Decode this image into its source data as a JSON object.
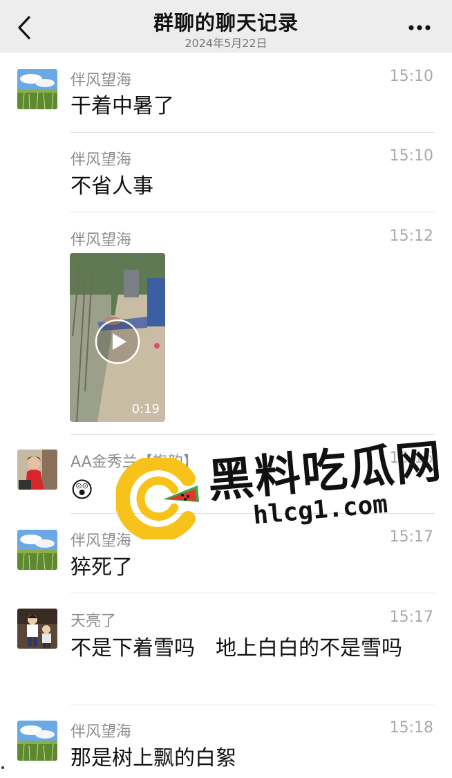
{
  "header": {
    "title": "群聊的聊天记录",
    "date": "2024年5月22日"
  },
  "messages": [
    {
      "sender": "伴风望海",
      "time": "15:10",
      "text": "干着中暑了",
      "avatar": "landscape-avatar"
    },
    {
      "sender": "伴风望海",
      "time": "15:10",
      "text": "不省人事",
      "avatar": "none"
    },
    {
      "sender": "伴风望海",
      "time": "15:12",
      "video_duration": "0:19",
      "avatar": "none"
    },
    {
      "sender": "AA金秀兰【旗韵】",
      "time": "15:16",
      "emoji": "😲",
      "avatar": "woman-avatar"
    },
    {
      "sender": "伴风望海",
      "time": "15:17",
      "text": "猝死了",
      "avatar": "landscape-avatar"
    },
    {
      "sender": "天亮了",
      "time": "15:17",
      "text": "不是下着雪吗　地上白白的不是雪吗",
      "avatar": "kids-avatar"
    },
    {
      "sender": "伴风望海",
      "time": "15:18",
      "text": "那是树上飘的白絮",
      "avatar": "landscape-avatar"
    }
  ],
  "watermark": {
    "brand": "黑料吃瓜网",
    "url": "hlcg1.com"
  },
  "colors": {
    "header_bg": "#ededed",
    "logo_yellow": "#f7c21a",
    "logo_red": "#e8322c",
    "logo_green": "#3aa845"
  }
}
